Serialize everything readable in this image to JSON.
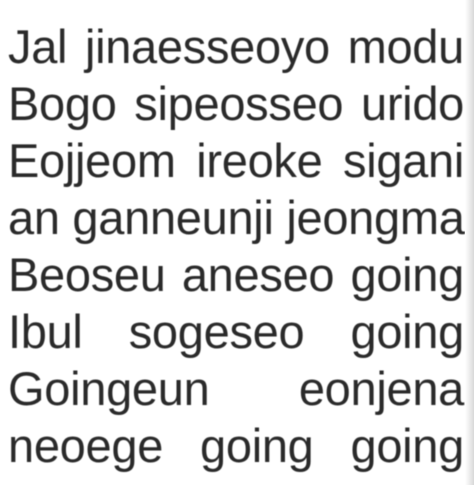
{
  "lines": [
    "Jal jinaesseoyo modu",
    "Bogo sipeosseo urido",
    "Eojjeom ireoke sigani",
    "an ganneunji jeongmal",
    "Beoseu aneseo going",
    "Ibul sogeseo going",
    "Goingeun eonjena",
    "neoege going going"
  ]
}
